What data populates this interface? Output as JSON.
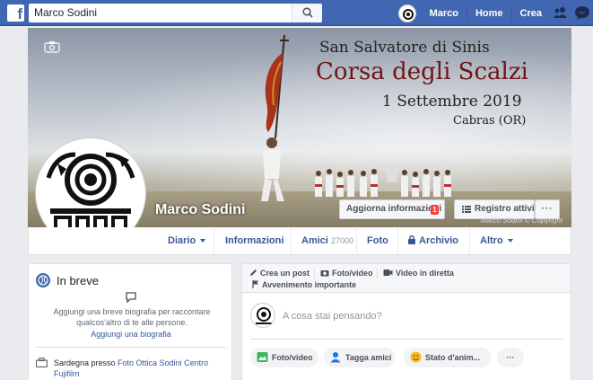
{
  "topbar": {
    "logo": "f",
    "search_value": "Marco Sodini",
    "user_name": "Marco",
    "home_label": "Home",
    "create_label": "Crea"
  },
  "cover": {
    "title_line1": "San Salvatore di Sinis",
    "title_line2": "Corsa degli Scalzi",
    "date": "1 Settembre 2019",
    "place": "Cabras (OR)",
    "watermark": "Marco Sodini © Copyright",
    "name": "Marco Sodini",
    "update_info_label": "Aggiorna informazioni",
    "update_badge": "1",
    "activity_log_label": "Registro attività",
    "more_label": "···"
  },
  "tabs": {
    "diario": "Diario",
    "informazioni": "Informazioni",
    "amici": "Amici",
    "amici_count": "27000",
    "foto": "Foto",
    "archivio": "Archivio",
    "altro": "Altro"
  },
  "intro": {
    "title": "In breve",
    "bio_text": "Aggiungi una breve biografia per raccontare qualcos'altro di te alle persone.",
    "bio_link": "Aggiungi una biografia",
    "work_prefix": "Sardegna presso ",
    "work_link": "Foto Ottica Sodini Centro Fujifilm"
  },
  "composer": {
    "create_post": "Crea un post",
    "photo_video_tab": "Foto/video",
    "live_video": "Video in diretta",
    "life_event": "Avvenimento importante",
    "placeholder": "A cosa stai pensando?",
    "photo_video_btn": "Foto/video",
    "tag_friends_btn": "Tagga amici",
    "feeling_btn": "Stato d'anim...",
    "more_btn": "···"
  },
  "colors": {
    "brand_blue": "#4267b2",
    "link_blue": "#365899",
    "cover_title_red": "#6e1414",
    "badge_red": "#fa3e3e"
  },
  "icons": [
    "facebook-logo-icon",
    "search-icon",
    "friends-icon",
    "messenger-icon",
    "camera-icon",
    "list-icon",
    "globe-icon",
    "speech-bubble-icon",
    "briefcase-icon",
    "pencil-icon",
    "photo-icon",
    "video-icon",
    "flag-icon",
    "tag-friend-icon",
    "smiley-icon",
    "lock-icon"
  ]
}
